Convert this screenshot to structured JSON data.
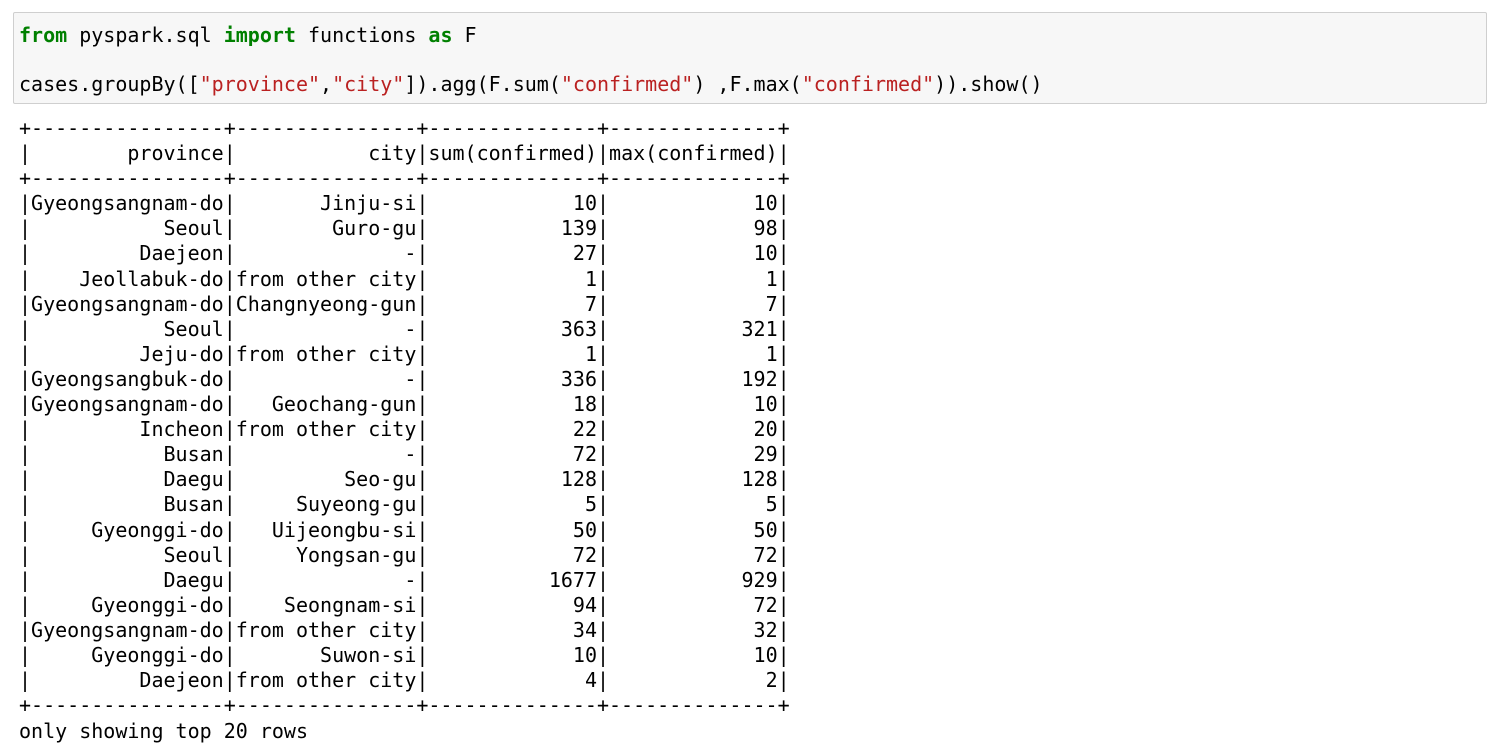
{
  "input_cell": {
    "line1": {
      "kw_from": "from",
      "module": " pyspark.sql ",
      "kw_import": "import",
      "names": " functions ",
      "kw_as": "as",
      "alias": " F"
    },
    "line2": {
      "t1": "cases.groupBy([",
      "s1": "\"province\"",
      "t2": ",",
      "s2": "\"city\"",
      "t3": "]).agg(F.sum(",
      "s3": "\"confirmed\"",
      "t4": ") ,F.max(",
      "s4": "\"confirmed\"",
      "t5": ")).show()"
    }
  },
  "output": {
    "border": "+----------------+---------------+--------------+--------------+",
    "header_row": {
      "columns": [
        "province",
        "city",
        "sum(confirmed)",
        "max(confirmed)"
      ]
    },
    "rows": [
      [
        "Gyeongsangnam-do",
        "Jinju-si",
        "10",
        "10"
      ],
      [
        "Seoul",
        "Guro-gu",
        "139",
        "98"
      ],
      [
        "Daejeon",
        "-",
        "27",
        "10"
      ],
      [
        "Jeollabuk-do",
        "from other city",
        "1",
        "1"
      ],
      [
        "Gyeongsangnam-do",
        "Changnyeong-gun",
        "7",
        "7"
      ],
      [
        "Seoul",
        "-",
        "363",
        "321"
      ],
      [
        "Jeju-do",
        "from other city",
        "1",
        "1"
      ],
      [
        "Gyeongsangbuk-do",
        "-",
        "336",
        "192"
      ],
      [
        "Gyeongsangnam-do",
        "Geochang-gun",
        "18",
        "10"
      ],
      [
        "Incheon",
        "from other city",
        "22",
        "20"
      ],
      [
        "Busan",
        "-",
        "72",
        "29"
      ],
      [
        "Daegu",
        "Seo-gu",
        "128",
        "128"
      ],
      [
        "Busan",
        "Suyeong-gu",
        "5",
        "5"
      ],
      [
        "Gyeonggi-do",
        "Uijeongbu-si",
        "50",
        "50"
      ],
      [
        "Seoul",
        "Yongsan-gu",
        "72",
        "72"
      ],
      [
        "Daegu",
        "-",
        "1677",
        "929"
      ],
      [
        "Gyeonggi-do",
        "Seongnam-si",
        "94",
        "72"
      ],
      [
        "Gyeongsangnam-do",
        "from other city",
        "34",
        "32"
      ],
      [
        "Gyeonggi-do",
        "Suwon-si",
        "10",
        "10"
      ],
      [
        "Daejeon",
        "from other city",
        "4",
        "2"
      ]
    ],
    "footer": "only showing top 20 rows"
  },
  "colors": {
    "keyword": "#008000",
    "string": "#ba2121",
    "cell_background": "#f7f7f7",
    "cell_border": "#cfcfcf"
  }
}
